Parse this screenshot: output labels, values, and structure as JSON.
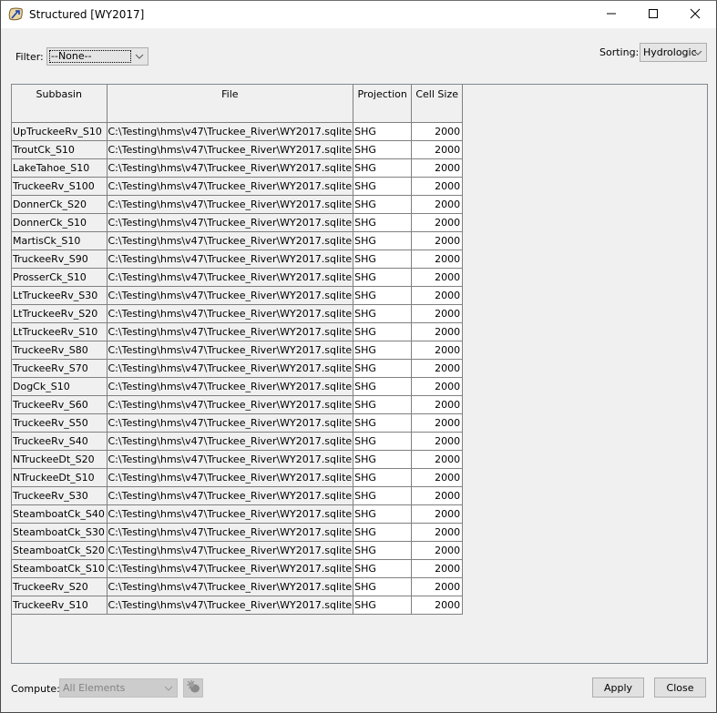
{
  "window": {
    "title": "Structured [WY2017]",
    "icon": "hms-app-icon",
    "controls": [
      "minimize-icon",
      "maximize-icon",
      "close-icon"
    ]
  },
  "filter": {
    "label": "Filter:",
    "value": "--None--"
  },
  "sorting": {
    "label": "Sorting:",
    "value": "Hydrologic"
  },
  "table": {
    "columns": [
      "Subbasin",
      "File",
      "Projection",
      "Cell Size"
    ],
    "rows": [
      {
        "subbasin": "UpTruckeeRv_S10",
        "file": "C:\\Testing\\hms\\v47\\Truckee_River\\WY2017.sqlite",
        "projection": "SHG",
        "cell_size": "2000"
      },
      {
        "subbasin": "TroutCk_S10",
        "file": "C:\\Testing\\hms\\v47\\Truckee_River\\WY2017.sqlite",
        "projection": "SHG",
        "cell_size": "2000"
      },
      {
        "subbasin": "LakeTahoe_S10",
        "file": "C:\\Testing\\hms\\v47\\Truckee_River\\WY2017.sqlite",
        "projection": "SHG",
        "cell_size": "2000"
      },
      {
        "subbasin": "TruckeeRv_S100",
        "file": "C:\\Testing\\hms\\v47\\Truckee_River\\WY2017.sqlite",
        "projection": "SHG",
        "cell_size": "2000"
      },
      {
        "subbasin": "DonnerCk_S20",
        "file": "C:\\Testing\\hms\\v47\\Truckee_River\\WY2017.sqlite",
        "projection": "SHG",
        "cell_size": "2000"
      },
      {
        "subbasin": "DonnerCk_S10",
        "file": "C:\\Testing\\hms\\v47\\Truckee_River\\WY2017.sqlite",
        "projection": "SHG",
        "cell_size": "2000"
      },
      {
        "subbasin": "MartisCk_S10",
        "file": "C:\\Testing\\hms\\v47\\Truckee_River\\WY2017.sqlite",
        "projection": "SHG",
        "cell_size": "2000"
      },
      {
        "subbasin": "TruckeeRv_S90",
        "file": "C:\\Testing\\hms\\v47\\Truckee_River\\WY2017.sqlite",
        "projection": "SHG",
        "cell_size": "2000"
      },
      {
        "subbasin": "ProsserCk_S10",
        "file": "C:\\Testing\\hms\\v47\\Truckee_River\\WY2017.sqlite",
        "projection": "SHG",
        "cell_size": "2000"
      },
      {
        "subbasin": "LtTruckeeRv_S30",
        "file": "C:\\Testing\\hms\\v47\\Truckee_River\\WY2017.sqlite",
        "projection": "SHG",
        "cell_size": "2000"
      },
      {
        "subbasin": "LtTruckeeRv_S20",
        "file": "C:\\Testing\\hms\\v47\\Truckee_River\\WY2017.sqlite",
        "projection": "SHG",
        "cell_size": "2000"
      },
      {
        "subbasin": "LtTruckeeRv_S10",
        "file": "C:\\Testing\\hms\\v47\\Truckee_River\\WY2017.sqlite",
        "projection": "SHG",
        "cell_size": "2000"
      },
      {
        "subbasin": "TruckeeRv_S80",
        "file": "C:\\Testing\\hms\\v47\\Truckee_River\\WY2017.sqlite",
        "projection": "SHG",
        "cell_size": "2000"
      },
      {
        "subbasin": "TruckeeRv_S70",
        "file": "C:\\Testing\\hms\\v47\\Truckee_River\\WY2017.sqlite",
        "projection": "SHG",
        "cell_size": "2000"
      },
      {
        "subbasin": "DogCk_S10",
        "file": "C:\\Testing\\hms\\v47\\Truckee_River\\WY2017.sqlite",
        "projection": "SHG",
        "cell_size": "2000"
      },
      {
        "subbasin": "TruckeeRv_S60",
        "file": "C:\\Testing\\hms\\v47\\Truckee_River\\WY2017.sqlite",
        "projection": "SHG",
        "cell_size": "2000"
      },
      {
        "subbasin": "TruckeeRv_S50",
        "file": "C:\\Testing\\hms\\v47\\Truckee_River\\WY2017.sqlite",
        "projection": "SHG",
        "cell_size": "2000"
      },
      {
        "subbasin": "TruckeeRv_S40",
        "file": "C:\\Testing\\hms\\v47\\Truckee_River\\WY2017.sqlite",
        "projection": "SHG",
        "cell_size": "2000"
      },
      {
        "subbasin": "NTruckeeDt_S20",
        "file": "C:\\Testing\\hms\\v47\\Truckee_River\\WY2017.sqlite",
        "projection": "SHG",
        "cell_size": "2000"
      },
      {
        "subbasin": "NTruckeeDt_S10",
        "file": "C:\\Testing\\hms\\v47\\Truckee_River\\WY2017.sqlite",
        "projection": "SHG",
        "cell_size": "2000"
      },
      {
        "subbasin": "TruckeeRv_S30",
        "file": "C:\\Testing\\hms\\v47\\Truckee_River\\WY2017.sqlite",
        "projection": "SHG",
        "cell_size": "2000"
      },
      {
        "subbasin": "SteamboatCk_S40",
        "file": "C:\\Testing\\hms\\v47\\Truckee_River\\WY2017.sqlite",
        "projection": "SHG",
        "cell_size": "2000"
      },
      {
        "subbasin": "SteamboatCk_S30",
        "file": "C:\\Testing\\hms\\v47\\Truckee_River\\WY2017.sqlite",
        "projection": "SHG",
        "cell_size": "2000"
      },
      {
        "subbasin": "SteamboatCk_S20",
        "file": "C:\\Testing\\hms\\v47\\Truckee_River\\WY2017.sqlite",
        "projection": "SHG",
        "cell_size": "2000"
      },
      {
        "subbasin": "SteamboatCk_S10",
        "file": "C:\\Testing\\hms\\v47\\Truckee_River\\WY2017.sqlite",
        "projection": "SHG",
        "cell_size": "2000"
      },
      {
        "subbasin": "TruckeeRv_S20",
        "file": "C:\\Testing\\hms\\v47\\Truckee_River\\WY2017.sqlite",
        "projection": "SHG",
        "cell_size": "2000"
      },
      {
        "subbasin": "TruckeeRv_S10",
        "file": "C:\\Testing\\hms\\v47\\Truckee_River\\WY2017.sqlite",
        "projection": "SHG",
        "cell_size": "2000"
      }
    ]
  },
  "compute": {
    "label": "Compute:",
    "value": "All Elements",
    "button_icon": "compute-bug-icon"
  },
  "buttons": {
    "apply": "Apply",
    "close": "Close"
  }
}
